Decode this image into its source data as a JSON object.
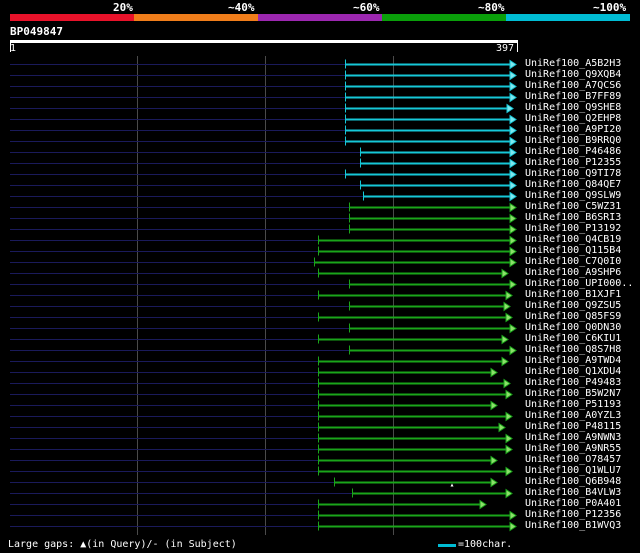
{
  "header": {
    "color_bar": [
      "#e8122a",
      "#f07d1a",
      "#9c27b0",
      "#0a9f0a",
      "#00bcd4"
    ],
    "labels": [
      "20%",
      "~40%",
      "~60%",
      "~80%",
      "~100%"
    ]
  },
  "query": {
    "name": "BP049847",
    "start": "1",
    "end": "397"
  },
  "colors": {
    "cyan": "#16c8d8",
    "green": "#1aa51a",
    "green_arrow": "#8ce06a",
    "cyan_arrow": "#7fe8f0",
    "gap_line": "#1a1a5a",
    "grid": "#4a4a4a"
  },
  "hits": [
    {
      "id": "UniRef100_A5B2H3",
      "color": "cyan",
      "start": 345,
      "end": 516
    },
    {
      "id": "UniRef100_Q9XQB4",
      "color": "cyan",
      "start": 345,
      "end": 516
    },
    {
      "id": "UniRef100_A7QCS6",
      "color": "cyan",
      "start": 345,
      "end": 516
    },
    {
      "id": "UniRef100_B7FF89",
      "color": "cyan",
      "start": 345,
      "end": 516
    },
    {
      "id": "UniRef100_Q9SHE8",
      "color": "cyan",
      "start": 345,
      "end": 513
    },
    {
      "id": "UniRef100_Q2EHP8",
      "color": "cyan",
      "start": 345,
      "end": 516
    },
    {
      "id": "UniRef100_A9PI20",
      "color": "cyan",
      "start": 345,
      "end": 516
    },
    {
      "id": "UniRef100_B9RRQ0",
      "color": "cyan",
      "start": 345,
      "end": 516
    },
    {
      "id": "UniRef100_P46486",
      "color": "cyan",
      "start": 360,
      "end": 516
    },
    {
      "id": "UniRef100_P12355",
      "color": "cyan",
      "start": 360,
      "end": 516
    },
    {
      "id": "UniRef100_Q9TI78",
      "color": "cyan",
      "start": 345,
      "end": 516
    },
    {
      "id": "UniRef100_Q84QE7",
      "color": "cyan",
      "start": 360,
      "end": 516
    },
    {
      "id": "UniRef100_Q9SLW9",
      "color": "cyan",
      "start": 363,
      "end": 516
    },
    {
      "id": "UniRef100_C5WZ31",
      "color": "green",
      "start": 349,
      "end": 516
    },
    {
      "id": "UniRef100_B6SRI3",
      "color": "green",
      "start": 349,
      "end": 516
    },
    {
      "id": "UniRef100_P13192",
      "color": "green",
      "start": 349,
      "end": 516
    },
    {
      "id": "UniRef100_Q4CB19",
      "color": "green",
      "start": 318,
      "end": 516
    },
    {
      "id": "UniRef100_Q115B4",
      "color": "green",
      "start": 318,
      "end": 516
    },
    {
      "id": "UniRef100_C7Q0I0",
      "color": "green",
      "start": 314,
      "end": 516
    },
    {
      "id": "UniRef100_A9SHP6",
      "color": "green",
      "start": 318,
      "end": 508
    },
    {
      "id": "UniRef100_UPI000..",
      "color": "green",
      "start": 349,
      "end": 516
    },
    {
      "id": "UniRef100_B1XJF1",
      "color": "green",
      "start": 318,
      "end": 512
    },
    {
      "id": "UniRef100_Q9ZSU5",
      "color": "green",
      "start": 349,
      "end": 510
    },
    {
      "id": "UniRef100_Q85FS9",
      "color": "green",
      "start": 318,
      "end": 512
    },
    {
      "id": "UniRef100_Q0DN30",
      "color": "green",
      "start": 349,
      "end": 516
    },
    {
      "id": "UniRef100_C6KIU1",
      "color": "green",
      "start": 318,
      "end": 508
    },
    {
      "id": "UniRef100_Q8S7H8",
      "color": "green",
      "start": 349,
      "end": 516
    },
    {
      "id": "UniRef100_A9TWD4",
      "color": "green",
      "start": 318,
      "end": 508
    },
    {
      "id": "UniRef100_Q1XDU4",
      "color": "green",
      "start": 318,
      "end": 497
    },
    {
      "id": "UniRef100_P49483",
      "color": "green",
      "start": 318,
      "end": 510
    },
    {
      "id": "UniRef100_B5W2N7",
      "color": "green",
      "start": 318,
      "end": 512
    },
    {
      "id": "UniRef100_P51193",
      "color": "green",
      "start": 318,
      "end": 497
    },
    {
      "id": "UniRef100_A0YZL3",
      "color": "green",
      "start": 318,
      "end": 512
    },
    {
      "id": "UniRef100_P48115",
      "color": "green",
      "start": 318,
      "end": 505
    },
    {
      "id": "UniRef100_A9NWN3",
      "color": "green",
      "start": 318,
      "end": 512
    },
    {
      "id": "UniRef100_A9NR55",
      "color": "green",
      "start": 318,
      "end": 512
    },
    {
      "id": "UniRef100_O78457",
      "color": "green",
      "start": 318,
      "end": 497
    },
    {
      "id": "UniRef100_Q1WLU7",
      "color": "green",
      "start": 318,
      "end": 512
    },
    {
      "id": "UniRef100_Q6B948",
      "color": "green",
      "start": 334,
      "end": 497,
      "mark_query_gap": 452
    },
    {
      "id": "UniRef100_B4VLW3",
      "color": "green",
      "start": 352,
      "end": 512
    },
    {
      "id": "UniRef100_P0A401",
      "color": "green",
      "start": 318,
      "end": 486
    },
    {
      "id": "UniRef100_P12356",
      "color": "green",
      "start": 318,
      "end": 516
    },
    {
      "id": "UniRef100_B1WVQ3",
      "color": "green",
      "start": 318,
      "end": 516
    }
  ],
  "legend": {
    "left": "Large gaps: ▲(in Query)/- (in Subject)",
    "right": "=100char."
  }
}
